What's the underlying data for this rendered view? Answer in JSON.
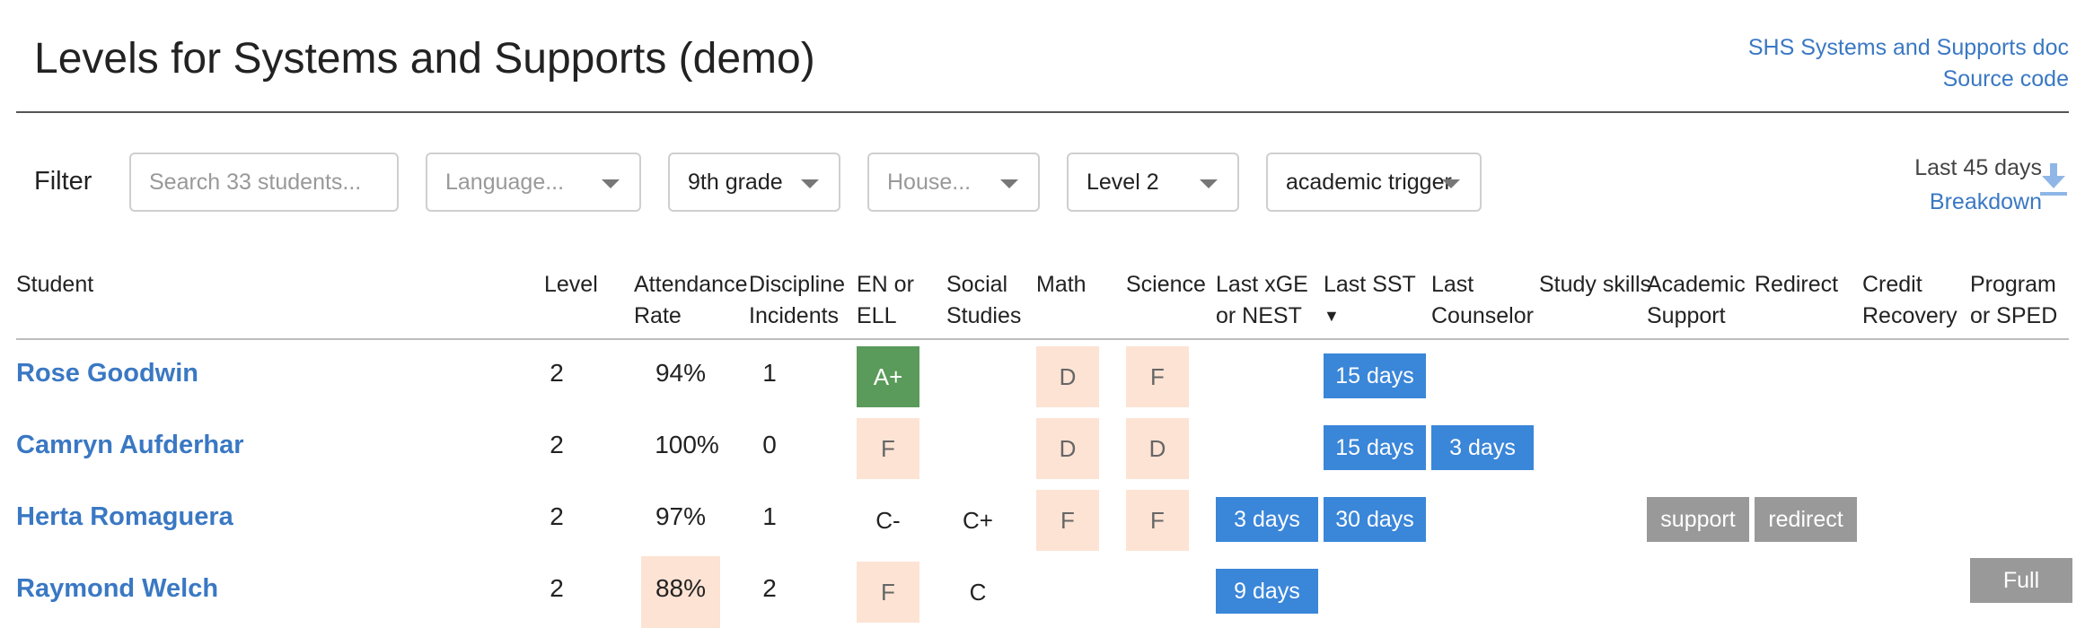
{
  "title": "Levels for Systems and Supports (demo)",
  "header_links": [
    "SHS Systems and Supports doc",
    "Source code"
  ],
  "filter": {
    "label": "Filter",
    "search_placeholder": "Search 33 students...",
    "language_placeholder": "Language...",
    "grade_value": "9th grade",
    "house_placeholder": "House...",
    "level_value": "Level 2",
    "trigger_value": "academic trigger"
  },
  "period": {
    "label": "Last 45 days",
    "breakdown": "Breakdown",
    "download_icon": "download-icon"
  },
  "columns": {
    "student": "Student",
    "level": "Level",
    "attendance": [
      "Attendance",
      "Rate"
    ],
    "discipline": [
      "Discipline",
      "Incidents"
    ],
    "en_ell": [
      "EN or",
      "ELL"
    ],
    "social": [
      "Social",
      "Studies"
    ],
    "math": "Math",
    "science": "Science",
    "xge": [
      "Last xGE",
      "or NEST"
    ],
    "sst": "Last SST",
    "sort_arrow": "▼",
    "counselor": [
      "Last",
      "Counselor"
    ],
    "study": "Study skills",
    "academic": [
      "Academic",
      "Support"
    ],
    "redirect": "Redirect",
    "credit": [
      "Credit",
      "Recovery"
    ],
    "program": [
      "Program",
      "or SPED"
    ]
  },
  "rows": [
    {
      "name": "Rose Goodwin",
      "level": "2",
      "attendance": "94%",
      "discipline": "1",
      "ell": "A+",
      "social": "",
      "math": "D",
      "science": "F",
      "xge": "",
      "sst": "15 days",
      "counselor": "",
      "academic": "",
      "redirect": "",
      "program": ""
    },
    {
      "name": "Camryn Aufderhar",
      "level": "2",
      "attendance": "100%",
      "discipline": "0",
      "ell": "F",
      "social": "",
      "math": "D",
      "science": "D",
      "xge": "",
      "sst": "15 days",
      "counselor": "3 days",
      "academic": "",
      "redirect": "",
      "program": ""
    },
    {
      "name": "Herta Romaguera",
      "level": "2",
      "attendance": "97%",
      "discipline": "1",
      "ell": "C-",
      "social": "C+",
      "math": "F",
      "science": "F",
      "xge": "3 days",
      "sst": "30 days",
      "counselor": "",
      "academic": "support",
      "redirect": "redirect",
      "program": ""
    },
    {
      "name": "Raymond Welch",
      "level": "2",
      "attendance": "88%",
      "discipline": "2",
      "ell": "F",
      "social": "C",
      "math": "",
      "science": "",
      "xge": "9 days",
      "sst": "",
      "counselor": "",
      "academic": "",
      "redirect": "",
      "program": "Full"
    }
  ],
  "colors": {
    "accent": "#3a78c3",
    "badge_blue": "#3a86d9",
    "badge_grey": "#999999",
    "grade_bad": "#fde3d4",
    "grade_good": "#5a9a5a"
  }
}
